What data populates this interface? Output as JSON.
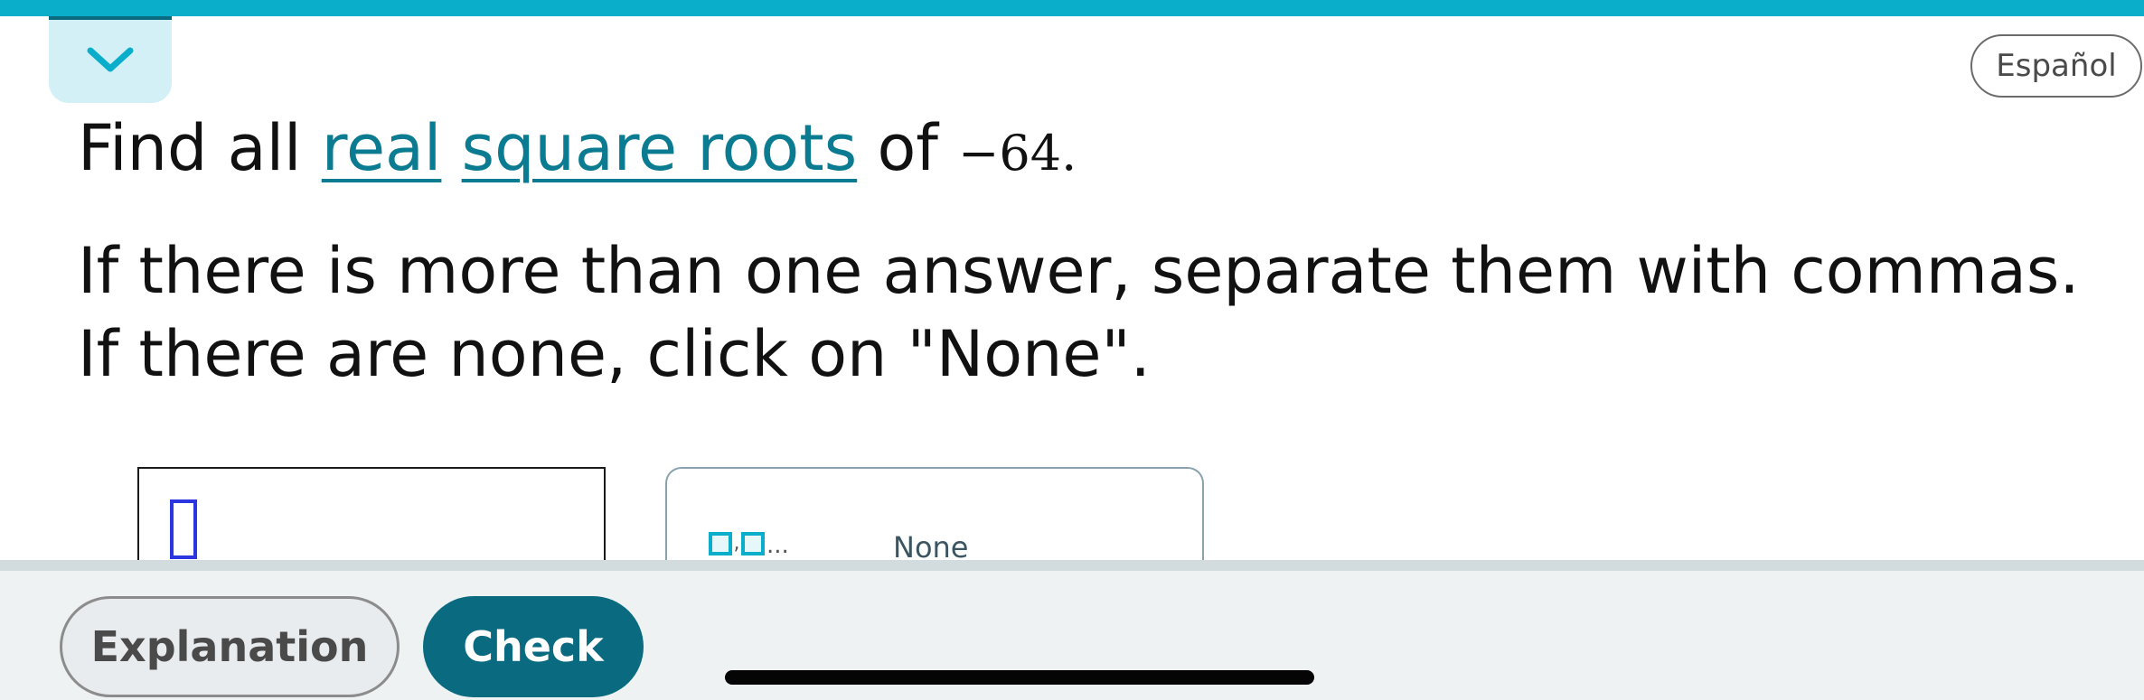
{
  "header": {
    "collapse_icon": "chevron-down-icon",
    "language_label": "Español"
  },
  "question": {
    "prefix": "Find all ",
    "term1": "real",
    "term2": "square roots",
    "of_word": " of ",
    "number": "−64.",
    "instruction_line1": "If there is more than one answer, separate them with commas.",
    "instruction_line2": "If there are none, click on \"None\"."
  },
  "answer": {
    "value": "",
    "list_key_dots": "...",
    "none_label": "None"
  },
  "footer": {
    "explanation_label": "Explanation",
    "check_label": "Check"
  },
  "colors": {
    "accent": "#0aaecb",
    "primary": "#0a6b80",
    "link": "#0a7b91"
  }
}
